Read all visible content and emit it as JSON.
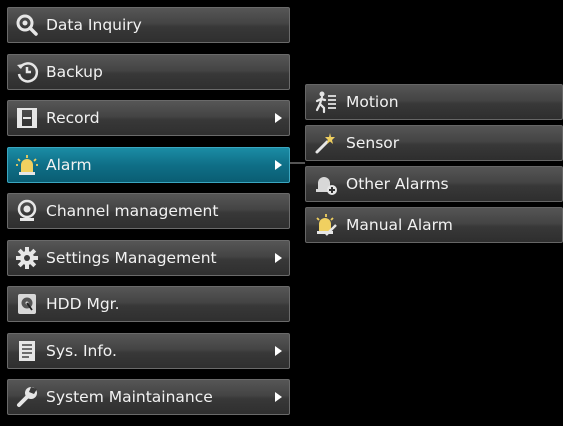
{
  "main_menu": {
    "items": [
      {
        "label": "Data Inquiry",
        "icon": "magnifier-icon",
        "has_submenu": false
      },
      {
        "label": "Backup",
        "icon": "backup-clock-icon",
        "has_submenu": false
      },
      {
        "label": "Record",
        "icon": "film-icon",
        "has_submenu": true
      },
      {
        "label": "Alarm",
        "icon": "alarm-siren-icon",
        "has_submenu": true,
        "active": true
      },
      {
        "label": "Channel management",
        "icon": "camera-icon",
        "has_submenu": false
      },
      {
        "label": "Settings Management",
        "icon": "gear-icon",
        "has_submenu": true
      },
      {
        "label": "HDD Mgr.",
        "icon": "hdd-icon",
        "has_submenu": false
      },
      {
        "label": "Sys. Info.",
        "icon": "document-icon",
        "has_submenu": true
      },
      {
        "label": "System Maintainance",
        "icon": "wrench-icon",
        "has_submenu": true
      }
    ]
  },
  "alarm_submenu": {
    "items": [
      {
        "label": "Motion",
        "icon": "motion-runner-icon"
      },
      {
        "label": "Sensor",
        "icon": "sensor-wand-icon"
      },
      {
        "label": "Other Alarms",
        "icon": "alarm-plus-icon"
      },
      {
        "label": "Manual Alarm",
        "icon": "manual-alarm-icon"
      }
    ]
  },
  "colors": {
    "active": "#0f6f87",
    "background": "#000000"
  }
}
